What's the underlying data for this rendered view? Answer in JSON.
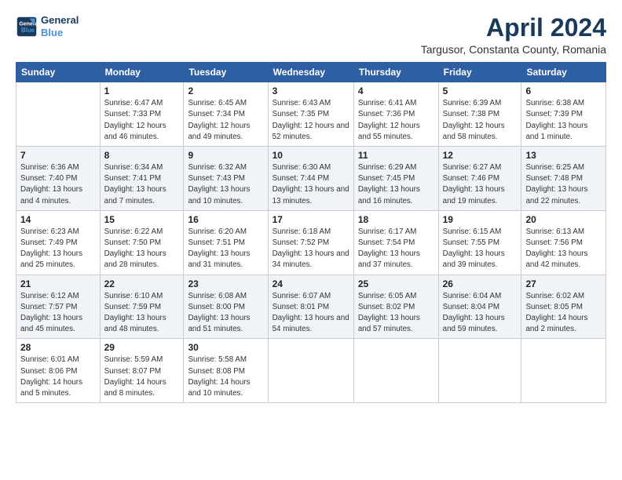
{
  "header": {
    "logo_line1": "General",
    "logo_line2": "Blue",
    "title": "April 2024",
    "subtitle": "Targusor, Constanta County, Romania"
  },
  "weekdays": [
    "Sunday",
    "Monday",
    "Tuesday",
    "Wednesday",
    "Thursday",
    "Friday",
    "Saturday"
  ],
  "weeks": [
    [
      {
        "day": "",
        "sunrise": "",
        "sunset": "",
        "daylight": ""
      },
      {
        "day": "1",
        "sunrise": "Sunrise: 6:47 AM",
        "sunset": "Sunset: 7:33 PM",
        "daylight": "Daylight: 12 hours and 46 minutes."
      },
      {
        "day": "2",
        "sunrise": "Sunrise: 6:45 AM",
        "sunset": "Sunset: 7:34 PM",
        "daylight": "Daylight: 12 hours and 49 minutes."
      },
      {
        "day": "3",
        "sunrise": "Sunrise: 6:43 AM",
        "sunset": "Sunset: 7:35 PM",
        "daylight": "Daylight: 12 hours and 52 minutes."
      },
      {
        "day": "4",
        "sunrise": "Sunrise: 6:41 AM",
        "sunset": "Sunset: 7:36 PM",
        "daylight": "Daylight: 12 hours and 55 minutes."
      },
      {
        "day": "5",
        "sunrise": "Sunrise: 6:39 AM",
        "sunset": "Sunset: 7:38 PM",
        "daylight": "Daylight: 12 hours and 58 minutes."
      },
      {
        "day": "6",
        "sunrise": "Sunrise: 6:38 AM",
        "sunset": "Sunset: 7:39 PM",
        "daylight": "Daylight: 13 hours and 1 minute."
      }
    ],
    [
      {
        "day": "7",
        "sunrise": "Sunrise: 6:36 AM",
        "sunset": "Sunset: 7:40 PM",
        "daylight": "Daylight: 13 hours and 4 minutes."
      },
      {
        "day": "8",
        "sunrise": "Sunrise: 6:34 AM",
        "sunset": "Sunset: 7:41 PM",
        "daylight": "Daylight: 13 hours and 7 minutes."
      },
      {
        "day": "9",
        "sunrise": "Sunrise: 6:32 AM",
        "sunset": "Sunset: 7:43 PM",
        "daylight": "Daylight: 13 hours and 10 minutes."
      },
      {
        "day": "10",
        "sunrise": "Sunrise: 6:30 AM",
        "sunset": "Sunset: 7:44 PM",
        "daylight": "Daylight: 13 hours and 13 minutes."
      },
      {
        "day": "11",
        "sunrise": "Sunrise: 6:29 AM",
        "sunset": "Sunset: 7:45 PM",
        "daylight": "Daylight: 13 hours and 16 minutes."
      },
      {
        "day": "12",
        "sunrise": "Sunrise: 6:27 AM",
        "sunset": "Sunset: 7:46 PM",
        "daylight": "Daylight: 13 hours and 19 minutes."
      },
      {
        "day": "13",
        "sunrise": "Sunrise: 6:25 AM",
        "sunset": "Sunset: 7:48 PM",
        "daylight": "Daylight: 13 hours and 22 minutes."
      }
    ],
    [
      {
        "day": "14",
        "sunrise": "Sunrise: 6:23 AM",
        "sunset": "Sunset: 7:49 PM",
        "daylight": "Daylight: 13 hours and 25 minutes."
      },
      {
        "day": "15",
        "sunrise": "Sunrise: 6:22 AM",
        "sunset": "Sunset: 7:50 PM",
        "daylight": "Daylight: 13 hours and 28 minutes."
      },
      {
        "day": "16",
        "sunrise": "Sunrise: 6:20 AM",
        "sunset": "Sunset: 7:51 PM",
        "daylight": "Daylight: 13 hours and 31 minutes."
      },
      {
        "day": "17",
        "sunrise": "Sunrise: 6:18 AM",
        "sunset": "Sunset: 7:52 PM",
        "daylight": "Daylight: 13 hours and 34 minutes."
      },
      {
        "day": "18",
        "sunrise": "Sunrise: 6:17 AM",
        "sunset": "Sunset: 7:54 PM",
        "daylight": "Daylight: 13 hours and 37 minutes."
      },
      {
        "day": "19",
        "sunrise": "Sunrise: 6:15 AM",
        "sunset": "Sunset: 7:55 PM",
        "daylight": "Daylight: 13 hours and 39 minutes."
      },
      {
        "day": "20",
        "sunrise": "Sunrise: 6:13 AM",
        "sunset": "Sunset: 7:56 PM",
        "daylight": "Daylight: 13 hours and 42 minutes."
      }
    ],
    [
      {
        "day": "21",
        "sunrise": "Sunrise: 6:12 AM",
        "sunset": "Sunset: 7:57 PM",
        "daylight": "Daylight: 13 hours and 45 minutes."
      },
      {
        "day": "22",
        "sunrise": "Sunrise: 6:10 AM",
        "sunset": "Sunset: 7:59 PM",
        "daylight": "Daylight: 13 hours and 48 minutes."
      },
      {
        "day": "23",
        "sunrise": "Sunrise: 6:08 AM",
        "sunset": "Sunset: 8:00 PM",
        "daylight": "Daylight: 13 hours and 51 minutes."
      },
      {
        "day": "24",
        "sunrise": "Sunrise: 6:07 AM",
        "sunset": "Sunset: 8:01 PM",
        "daylight": "Daylight: 13 hours and 54 minutes."
      },
      {
        "day": "25",
        "sunrise": "Sunrise: 6:05 AM",
        "sunset": "Sunset: 8:02 PM",
        "daylight": "Daylight: 13 hours and 57 minutes."
      },
      {
        "day": "26",
        "sunrise": "Sunrise: 6:04 AM",
        "sunset": "Sunset: 8:04 PM",
        "daylight": "Daylight: 13 hours and 59 minutes."
      },
      {
        "day": "27",
        "sunrise": "Sunrise: 6:02 AM",
        "sunset": "Sunset: 8:05 PM",
        "daylight": "Daylight: 14 hours and 2 minutes."
      }
    ],
    [
      {
        "day": "28",
        "sunrise": "Sunrise: 6:01 AM",
        "sunset": "Sunset: 8:06 PM",
        "daylight": "Daylight: 14 hours and 5 minutes."
      },
      {
        "day": "29",
        "sunrise": "Sunrise: 5:59 AM",
        "sunset": "Sunset: 8:07 PM",
        "daylight": "Daylight: 14 hours and 8 minutes."
      },
      {
        "day": "30",
        "sunrise": "Sunrise: 5:58 AM",
        "sunset": "Sunset: 8:08 PM",
        "daylight": "Daylight: 14 hours and 10 minutes."
      },
      {
        "day": "",
        "sunrise": "",
        "sunset": "",
        "daylight": ""
      },
      {
        "day": "",
        "sunrise": "",
        "sunset": "",
        "daylight": ""
      },
      {
        "day": "",
        "sunrise": "",
        "sunset": "",
        "daylight": ""
      },
      {
        "day": "",
        "sunrise": "",
        "sunset": "",
        "daylight": ""
      }
    ]
  ]
}
